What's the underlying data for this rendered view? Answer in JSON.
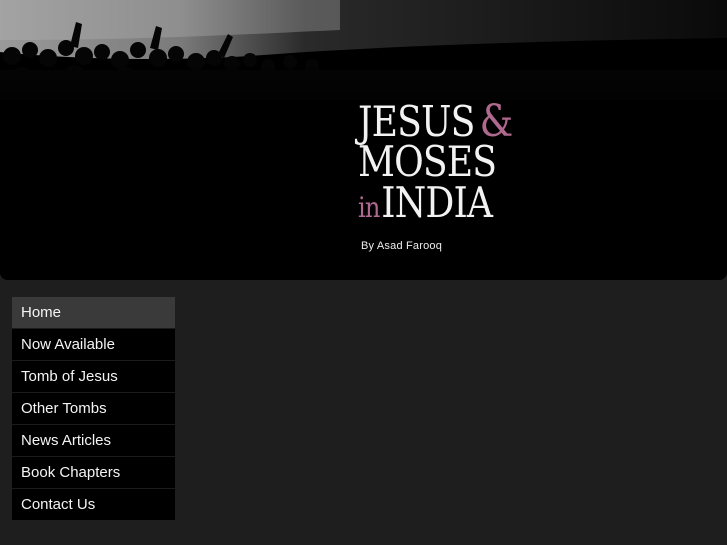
{
  "header": {
    "title_line1_word": "JESUS",
    "title_amp": "&",
    "title_line2": "MOSES",
    "title_in": "in",
    "title_line3_word": "INDIA",
    "byline": "By Asad Farooq"
  },
  "nav": {
    "items": [
      {
        "label": "Home",
        "active": true
      },
      {
        "label": "Now Available",
        "active": false
      },
      {
        "label": "Tomb of Jesus",
        "active": false
      },
      {
        "label": "Other Tombs",
        "active": false
      },
      {
        "label": "News Articles",
        "active": false
      },
      {
        "label": "Book Chapters",
        "active": false
      },
      {
        "label": "Contact Us",
        "active": false
      }
    ]
  },
  "colors": {
    "accent": "#b0698e",
    "banner_bg": "#000000",
    "page_bg": "#1e1e1e",
    "nav_active": "#3a3a3a"
  }
}
